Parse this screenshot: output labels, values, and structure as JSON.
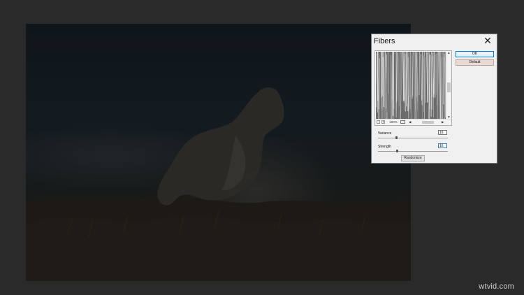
{
  "dialog": {
    "title": "Fibers",
    "close_icon": "close-icon",
    "ok_label": "OK",
    "default_label": "Default",
    "randomize_label": "Randomize",
    "zoom": "100%",
    "variance": {
      "label": "Variance",
      "value": "16",
      "slider_fraction": 0.26
    },
    "strength": {
      "label": "Strength",
      "value": "16",
      "slider_fraction": 0.27
    }
  },
  "canvas": {
    "subject": "dog-silhouette-photo"
  },
  "watermark": "wtvid.com",
  "colors": {
    "ok_border": "#0078d7",
    "default_button": "#e9d8d4",
    "workspace": "#2a2a2a"
  }
}
